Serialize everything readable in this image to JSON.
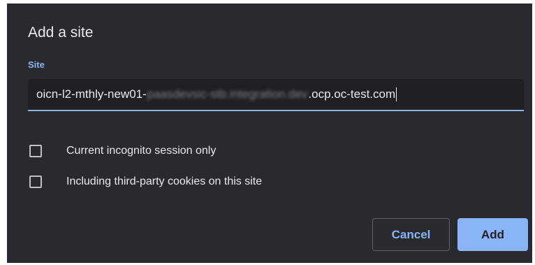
{
  "dialog": {
    "title": "Add a site",
    "site_field": {
      "label": "Site",
      "value_prefix": "oicn-l2-mthly-new01-",
      "value_obscured": "paasdevsic-stb.integration.dev",
      "value_suffix": ".ocp.oc-test.com"
    },
    "options": [
      {
        "label": "Current incognito session only",
        "checked": false
      },
      {
        "label": "Including third-party cookies on this site",
        "checked": false
      }
    ],
    "buttons": {
      "cancel_label": "Cancel",
      "add_label": "Add"
    }
  },
  "colors": {
    "dialog_bg": "#292a2d",
    "input_bg": "#1f2023",
    "accent": "#8ab4f8",
    "text_primary": "#e8eaed",
    "checkbox_border": "#bdc1c6"
  }
}
